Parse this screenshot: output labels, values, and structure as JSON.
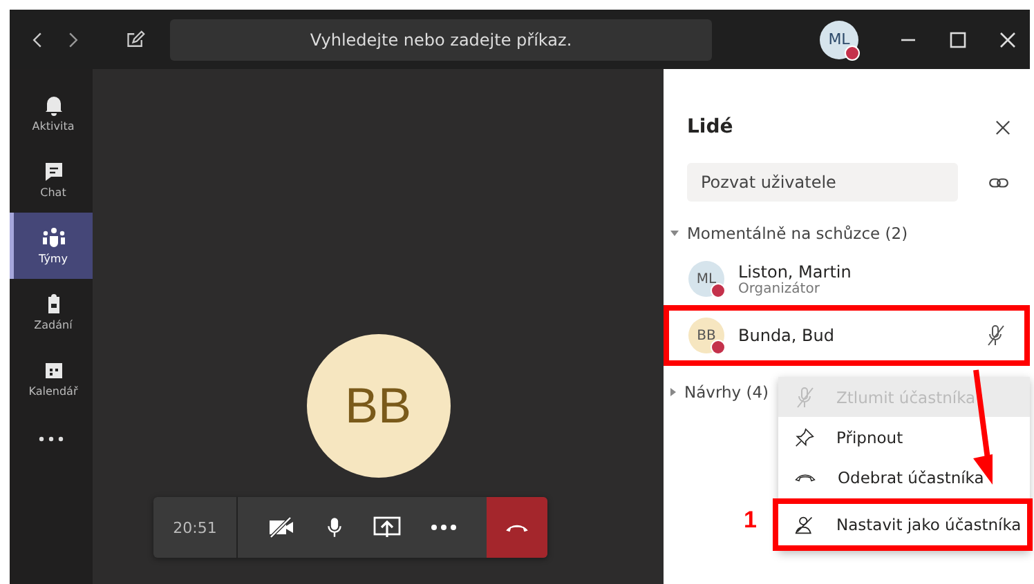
{
  "title_bar": {
    "search_placeholder": "Vyhledejte nebo zadejte příkaz.",
    "avatar": "ML"
  },
  "rail": [
    {
      "label": "Aktivita",
      "kind": "bell",
      "selected": false
    },
    {
      "label": "Chat",
      "kind": "chat",
      "selected": false
    },
    {
      "label": "Týmy",
      "kind": "teams",
      "selected": true
    },
    {
      "label": "Zadání",
      "kind": "bag",
      "selected": false
    },
    {
      "label": "Kalendář",
      "kind": "calendar",
      "selected": false
    }
  ],
  "call": {
    "avatar": "BB",
    "timer": "20:51"
  },
  "people": {
    "title": "Lidé",
    "invite_placeholder": "Pozvat uživatele",
    "section": "Momentálně na schůzce (2)",
    "section_expanded": true,
    "participants": [
      {
        "initials": "ML",
        "name": "Liston, Martin",
        "role": "Organizátor",
        "color": "#d6e4ec",
        "marked": false
      },
      {
        "initials": "BB",
        "name": "Bunda, Bud",
        "color": "#f6e6c0",
        "marked": true
      }
    ],
    "suggestions": "Návrhy (4)"
  },
  "menu": [
    {
      "label": "Ztlumit účastníka",
      "kind": "mic-off",
      "disabled": true,
      "marked": false
    },
    {
      "label": "Připnout",
      "kind": "pin",
      "disabled": false,
      "marked": false
    },
    {
      "label": "Odebrat účastníka",
      "kind": "phone",
      "disabled": false,
      "marked": false
    },
    {
      "label": "Nastavit jako účastníka",
      "kind": "attendee",
      "disabled": false,
      "marked": true
    }
  ],
  "annotation": {
    "label": "1"
  }
}
